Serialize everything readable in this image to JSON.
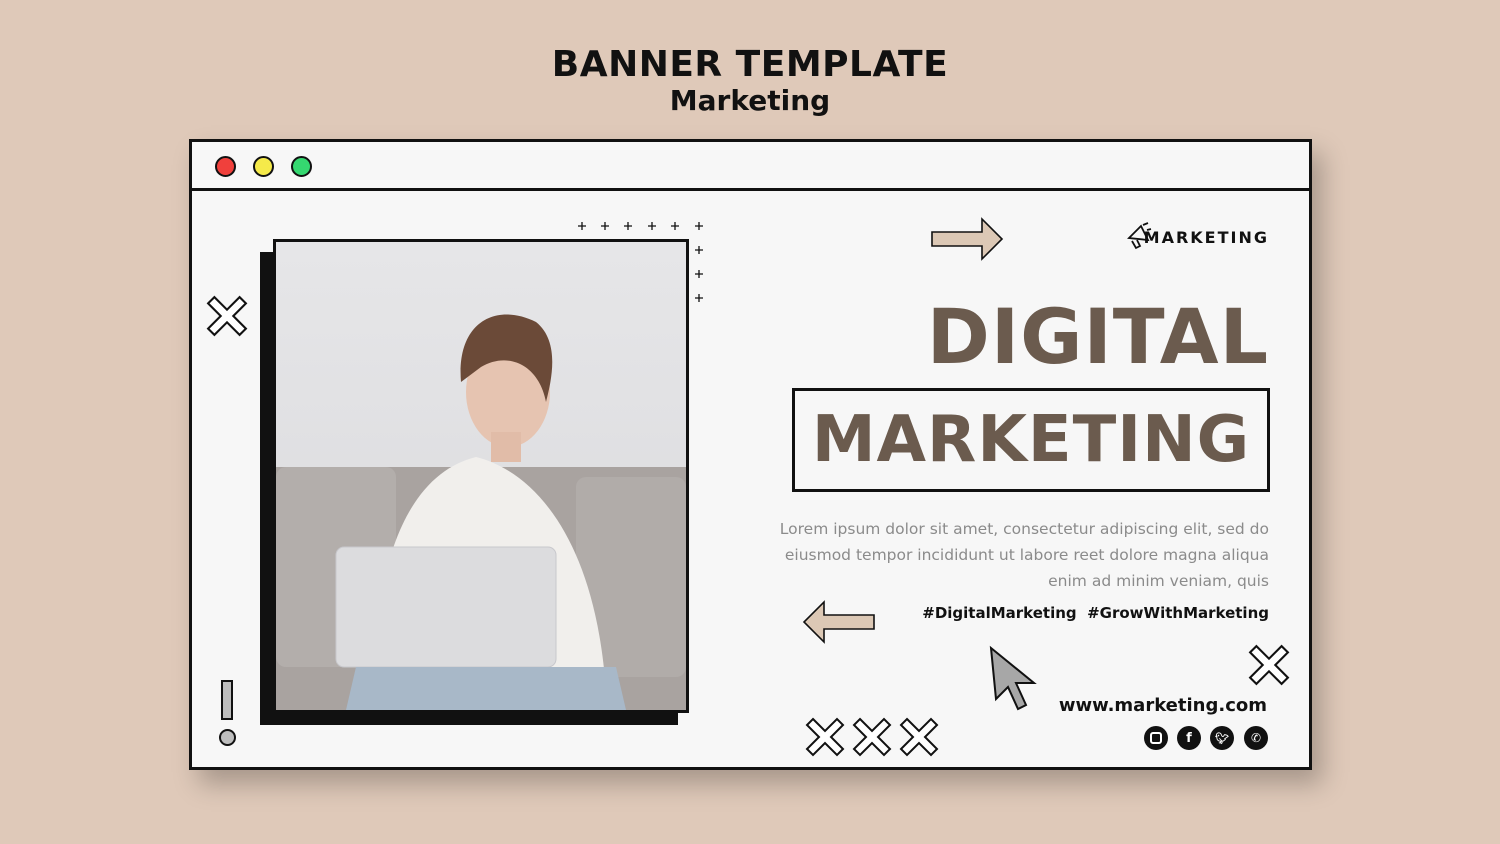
{
  "header": {
    "title": "BANNER TEMPLATE",
    "subtitle": "Marketing"
  },
  "window": {
    "dots": [
      {
        "color": "#f0403c"
      },
      {
        "color": "#f5ea4a"
      },
      {
        "color": "#35d870"
      }
    ]
  },
  "banner": {
    "tagline": "MARKETING",
    "headline_1": "DIGITAL",
    "headline_2": "MARKETING",
    "body": "Lorem ipsum dolor sit amet, consectetur adipiscing elit, sed do eiusmod tempor incididunt ut labore reet dolore magna aliqua enim ad minim veniam, quis",
    "hashtags": "#DigitalMarketing  #GrowWithMarketing",
    "url": "www.marketing.com",
    "social": [
      "instagram-icon",
      "facebook-icon",
      "twitter-icon",
      "whatsapp-icon"
    ]
  },
  "colors": {
    "background": "#dfc9b9",
    "accent": "#6b5b4e",
    "arrow_fill": "#dcc8b5"
  }
}
